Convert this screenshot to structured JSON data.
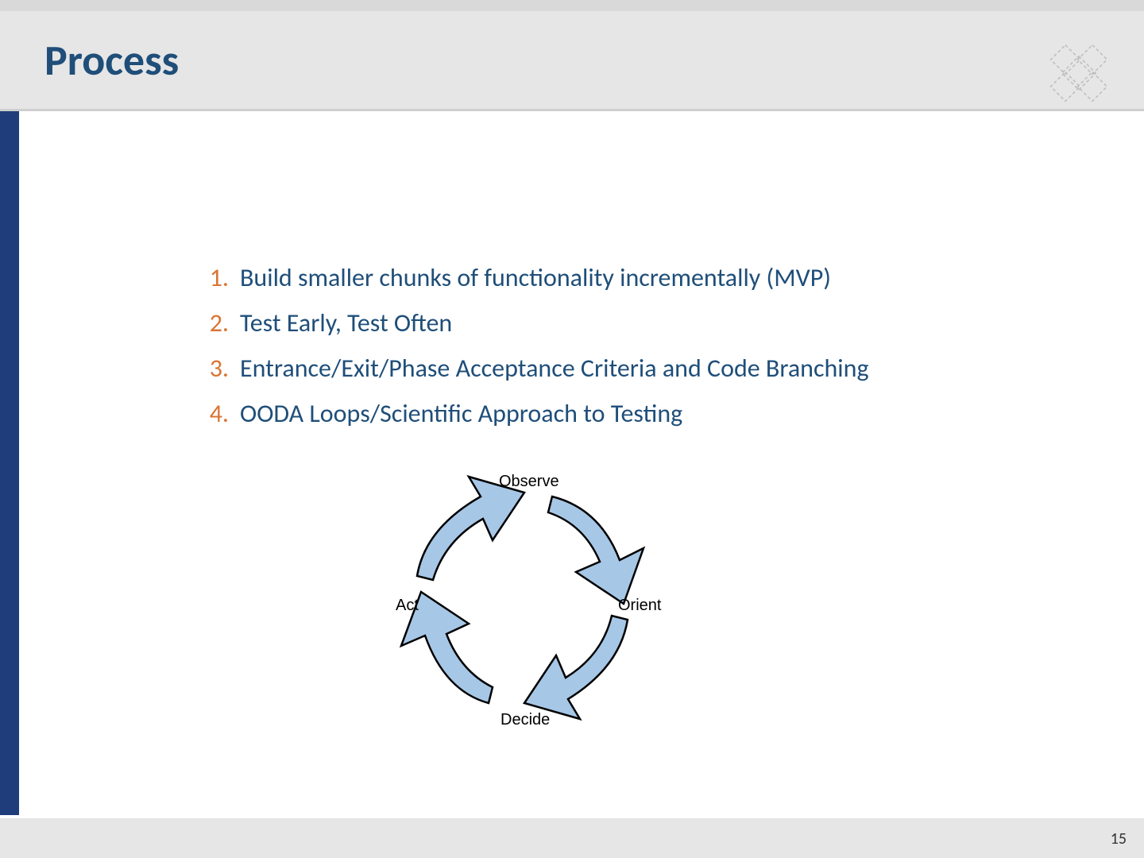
{
  "title": "Process",
  "list_items": [
    {
      "num": "1.",
      "text": "Build smaller chunks of functionality incrementally (MVP)"
    },
    {
      "num": "2.",
      "text": "Test Early, Test Often"
    },
    {
      "num": "3.",
      "text": "Entrance/Exit/Phase Acceptance Criteria and Code Branching"
    },
    {
      "num": "4.",
      "text": "OODA Loops/Scientific Approach to Testing"
    }
  ],
  "ooda": {
    "top": "Observe",
    "right": "Orient",
    "bottom": "Decide",
    "left": "Act"
  },
  "page_number": "15"
}
